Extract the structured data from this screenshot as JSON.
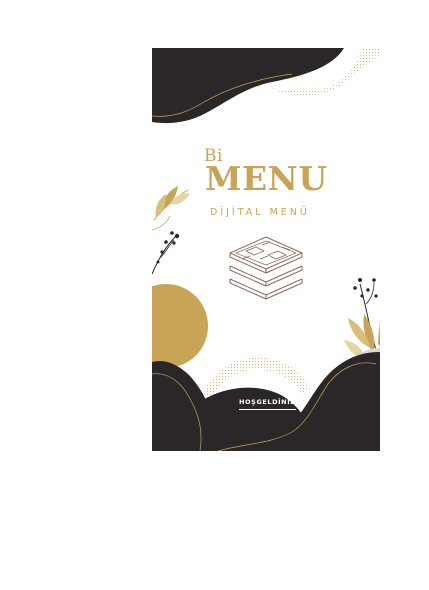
{
  "brand": {
    "prefix": "Bi",
    "name": "MENU",
    "subtitle": "DİJİTAL MENÜ"
  },
  "welcome_link": "HOŞGELDİNİZ",
  "icons": {
    "center": "menu-stack-icon",
    "left_branch": "leaf-branch-icon",
    "right_branch": "leaf-branch-icon"
  },
  "colors": {
    "dark": "#2b2729",
    "gold": "#c8a457",
    "gold_light": "#e6d4a8",
    "background": "#ffffff",
    "icon_stroke": "#8a6a5f"
  }
}
